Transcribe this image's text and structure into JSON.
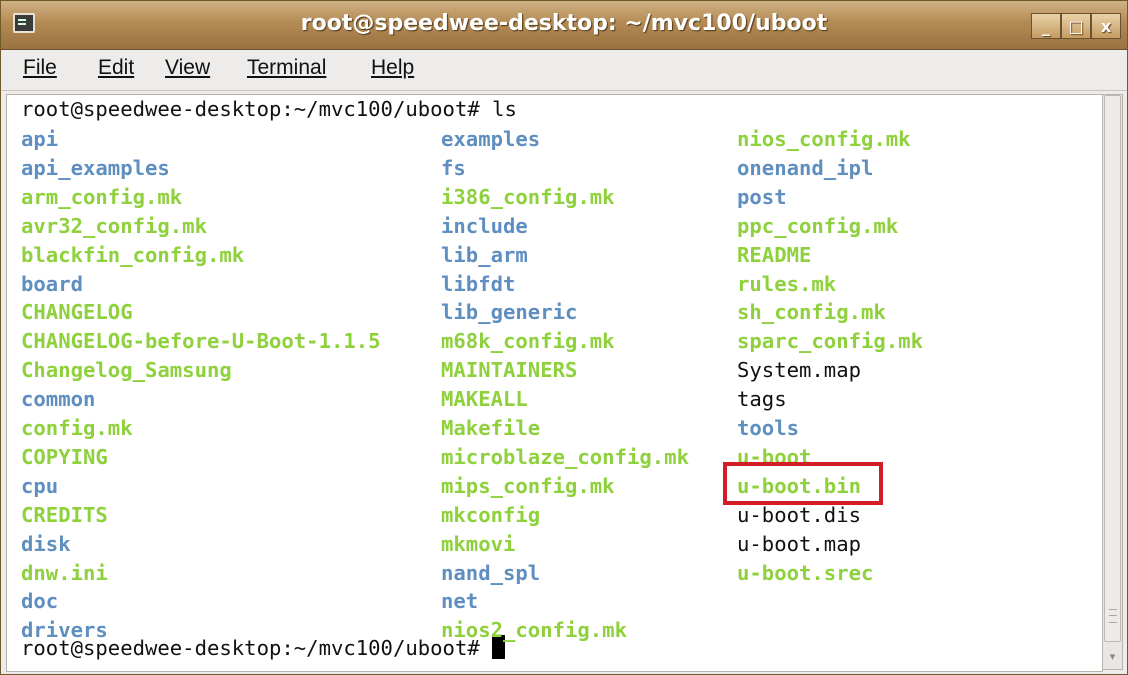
{
  "window": {
    "title": "root@speedwee-desktop: ~/mvc100/uboot",
    "minimize_label": "_",
    "maximize_label": "□",
    "close_label": "x"
  },
  "menu": {
    "file": "File",
    "edit": "Edit",
    "view": "View",
    "terminal": "Terminal",
    "help": "Help"
  },
  "terminal": {
    "command_line": "root@speedwee-desktop:~/mvc100/uboot# ls",
    "prompt": "root@speedwee-desktop:~/mvc100/uboot# ",
    "colors": {
      "directory": "#5f8fc0",
      "executable": "#8ed13c",
      "plain": "#111111"
    },
    "columns": [
      [
        {
          "name": "api",
          "type": "dir"
        },
        {
          "name": "api_examples",
          "type": "dir"
        },
        {
          "name": "arm_config.mk",
          "type": "exe"
        },
        {
          "name": "avr32_config.mk",
          "type": "exe"
        },
        {
          "name": "blackfin_config.mk",
          "type": "exe"
        },
        {
          "name": "board",
          "type": "dir"
        },
        {
          "name": "CHANGELOG",
          "type": "exe"
        },
        {
          "name": "CHANGELOG-before-U-Boot-1.1.5",
          "type": "exe"
        },
        {
          "name": "Changelog_Samsung",
          "type": "exe"
        },
        {
          "name": "common",
          "type": "dir"
        },
        {
          "name": "config.mk",
          "type": "exe"
        },
        {
          "name": "COPYING",
          "type": "exe"
        },
        {
          "name": "cpu",
          "type": "dir"
        },
        {
          "name": "CREDITS",
          "type": "exe"
        },
        {
          "name": "disk",
          "type": "dir"
        },
        {
          "name": "dnw.ini",
          "type": "exe"
        },
        {
          "name": "doc",
          "type": "dir"
        },
        {
          "name": "drivers",
          "type": "dir"
        }
      ],
      [
        {
          "name": "examples",
          "type": "dir"
        },
        {
          "name": "fs",
          "type": "dir"
        },
        {
          "name": "i386_config.mk",
          "type": "exe"
        },
        {
          "name": "include",
          "type": "dir"
        },
        {
          "name": "lib_arm",
          "type": "dir"
        },
        {
          "name": "libfdt",
          "type": "dir"
        },
        {
          "name": "lib_generic",
          "type": "dir"
        },
        {
          "name": "m68k_config.mk",
          "type": "exe"
        },
        {
          "name": "MAINTAINERS",
          "type": "exe"
        },
        {
          "name": "MAKEALL",
          "type": "exe"
        },
        {
          "name": "Makefile",
          "type": "exe"
        },
        {
          "name": "microblaze_config.mk",
          "type": "exe"
        },
        {
          "name": "mips_config.mk",
          "type": "exe"
        },
        {
          "name": "mkconfig",
          "type": "exe"
        },
        {
          "name": "mkmovi",
          "type": "exe"
        },
        {
          "name": "nand_spl",
          "type": "dir"
        },
        {
          "name": "net",
          "type": "dir"
        },
        {
          "name": "nios2_config.mk",
          "type": "exe"
        }
      ],
      [
        {
          "name": "nios_config.mk",
          "type": "exe"
        },
        {
          "name": "onenand_ipl",
          "type": "dir"
        },
        {
          "name": "post",
          "type": "dir"
        },
        {
          "name": "ppc_config.mk",
          "type": "exe"
        },
        {
          "name": "README",
          "type": "exe"
        },
        {
          "name": "rules.mk",
          "type": "exe"
        },
        {
          "name": "sh_config.mk",
          "type": "exe"
        },
        {
          "name": "sparc_config.mk",
          "type": "exe"
        },
        {
          "name": "System.map",
          "type": "plain"
        },
        {
          "name": "tags",
          "type": "plain"
        },
        {
          "name": "tools",
          "type": "dir"
        },
        {
          "name": "u-boot",
          "type": "exe"
        },
        {
          "name": "u-boot.bin",
          "type": "exe"
        },
        {
          "name": "u-boot.dis",
          "type": "plain"
        },
        {
          "name": "u-boot.map",
          "type": "plain"
        },
        {
          "name": "u-boot.srec",
          "type": "exe"
        }
      ]
    ]
  }
}
